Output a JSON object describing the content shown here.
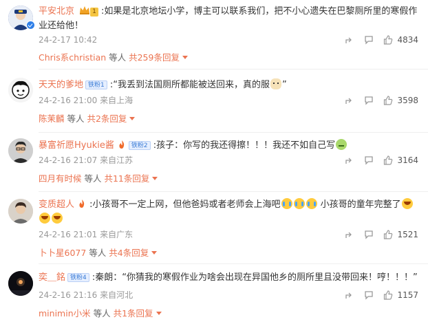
{
  "comments": [
    {
      "username": "平安北京",
      "badge": "",
      "level": "1",
      "text": ":如果是北京地坛小学，博主可以联系我们，把不小心遗失在巴黎厕所里的寒假作业还给他！",
      "time": "24-2-17 10:42",
      "location": "",
      "likes": "4834",
      "reply_user": "Chris系christian",
      "reply_mid": " 等人 ",
      "reply_count": "共259条回复"
    },
    {
      "username": "天天的爹地",
      "badge": "铁粉1",
      "text": ":“我丢到法国厕所都能被送回来，真的服",
      "text_end": "”",
      "time": "24-2-16 21:00",
      "location": "来自上海",
      "likes": "3598",
      "reply_user": "陈茉麟",
      "reply_mid": " 等人 ",
      "reply_count": "共2条回复"
    },
    {
      "username": "暴富祈愿Hyukie酱",
      "badge": "铁粉2",
      "text": ":孩子：你写的我还得擦！！！我还不如自己写",
      "time": "24-2-16 21:07",
      "location": "来自江苏",
      "likes": "3164",
      "reply_user": "四月有时候",
      "reply_mid": " 等人 ",
      "reply_count": "共11条回复"
    },
    {
      "username": "变质超人",
      "badge": "",
      "text": ":小孩哥不一定上网，但他爸妈或者老师会上海吧",
      "text_2": " 小孩哥的童年完整了",
      "time": "24-2-16 21:01",
      "location": "来自广东",
      "likes": "1521",
      "reply_user": "卜卜星6077",
      "reply_mid": " 等人 ",
      "reply_count": "共4条回复"
    },
    {
      "username": "奕＿銘",
      "badge": "铁粉4",
      "text": ":秦朗：“你猜我的寒假作业为啥会出现在异国他乡的厕所里且没带回来！哼！！！”",
      "time": "24-2-16 21:16",
      "location": "来自河北",
      "likes": "1157",
      "reply_user": "minimin小米",
      "reply_mid": " 等人 ",
      "reply_count": "共1条回复"
    }
  ]
}
